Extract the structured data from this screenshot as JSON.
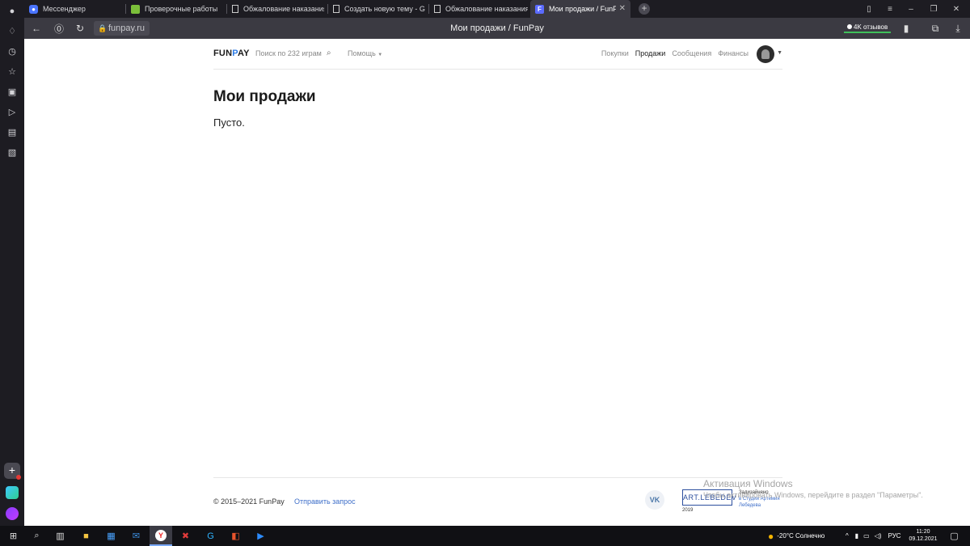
{
  "browser": {
    "tabs": [
      {
        "label": "Мессенджер",
        "icon": "messenger-icon"
      },
      {
        "label": "Проверочные работы",
        "icon": "book-icon"
      },
      {
        "label": "Обжалование наказания",
        "icon": "page-icon"
      },
      {
        "label": "Создать новую тему - GTA",
        "icon": "page-icon"
      },
      {
        "label": "Обжалование наказания",
        "icon": "page-icon"
      },
      {
        "label": "Мои продажи / FunPay",
        "icon": "funpay-icon",
        "active": true
      }
    ],
    "address": "funpay.ru",
    "page_title": "Мои продажи / FunPay",
    "reviews_badge": "4K отзывов"
  },
  "site": {
    "logo_left": "FUN",
    "logo_mid": "P",
    "logo_right": "AY",
    "search_placeholder": "Поиск по 232 играм",
    "help_label": "Помощь",
    "nav": [
      "Покупки",
      "Продажи",
      "Сообщения",
      "Финансы"
    ],
    "nav_current": "Продажи"
  },
  "main": {
    "heading": "Мои продажи",
    "empty_text": "Пусто."
  },
  "footer": {
    "copyright": "© 2015–2021 FunPay",
    "send_request": "Отправить запрос",
    "vk": "VK",
    "artlebedev": "ART.LEBEDEV",
    "year": "2019",
    "designed_line1": "Задизайнено",
    "designed_line2": "в Студии Артемия",
    "designed_line3": "Лебедева"
  },
  "windows": {
    "activation_title": "Активация Windows",
    "activation_text": "Чтобы активировать Windows, перейдите в раздел \"Параметры\".",
    "weather": "-20°C  Солнечно",
    "lang": "РУС",
    "time": "11:20",
    "date": "09.12.2021"
  },
  "colors": {
    "accent_link": "#3d6ec9",
    "reviews_underline": "#3fbf5a"
  }
}
